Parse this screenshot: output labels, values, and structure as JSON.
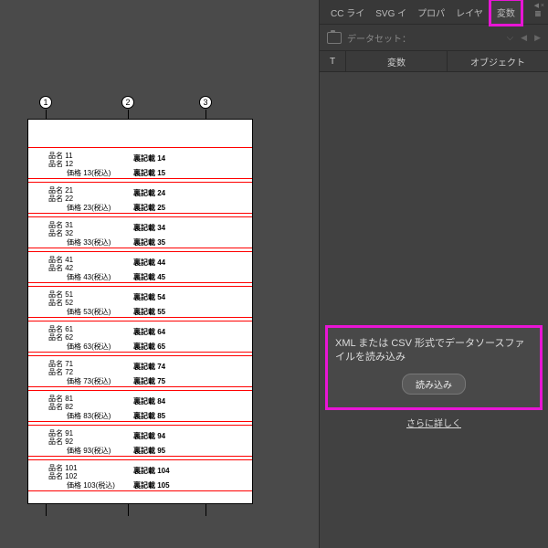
{
  "tabs": {
    "t0": "CC ライ",
    "t1": "SVG イ",
    "t2": "プロパ",
    "t3": "レイヤ",
    "t4": "変数"
  },
  "dataset_label": "データセット：",
  "columns": {
    "c0": "T",
    "c1": "変数",
    "c2": "オブジェクト"
  },
  "import": {
    "text": "XML または CSV 形式でデータソースファイルを読み込み",
    "button": "読み込み"
  },
  "more_link": "さらに詳しく",
  "markers": {
    "m1": "1",
    "m2": "2",
    "m3": "3"
  },
  "rows": [
    {
      "a1": "品名 11",
      "a2": "品名 12",
      "price": "価格 13(税込)",
      "b": "裏記載 14",
      "c": "裏記載 15"
    },
    {
      "a1": "品名 21",
      "a2": "品名 22",
      "price": "価格 23(税込)",
      "b": "裏記載 24",
      "c": "裏記載 25"
    },
    {
      "a1": "品名 31",
      "a2": "品名 32",
      "price": "価格 33(税込)",
      "b": "裏記載 34",
      "c": "裏記載 35"
    },
    {
      "a1": "品名 41",
      "a2": "品名 42",
      "price": "価格 43(税込)",
      "b": "裏記載 44",
      "c": "裏記載 45"
    },
    {
      "a1": "品名 51",
      "a2": "品名 52",
      "price": "価格 53(税込)",
      "b": "裏記載 54",
      "c": "裏記載 55"
    },
    {
      "a1": "品名 61",
      "a2": "品名 62",
      "price": "価格 63(税込)",
      "b": "裏記載 64",
      "c": "裏記載 65"
    },
    {
      "a1": "品名 71",
      "a2": "品名 72",
      "price": "価格 73(税込)",
      "b": "裏記載 74",
      "c": "裏記載 75"
    },
    {
      "a1": "品名 81",
      "a2": "品名 82",
      "price": "価格 83(税込)",
      "b": "裏記載 84",
      "c": "裏記載 85"
    },
    {
      "a1": "品名 91",
      "a2": "品名 92",
      "price": "価格 93(税込)",
      "b": "裏記載 94",
      "c": "裏記載 95"
    },
    {
      "a1": "品名 101",
      "a2": "品名 102",
      "price": "価格 103(税込)",
      "b": "裏記載 104",
      "c": "裏記載 105"
    }
  ]
}
